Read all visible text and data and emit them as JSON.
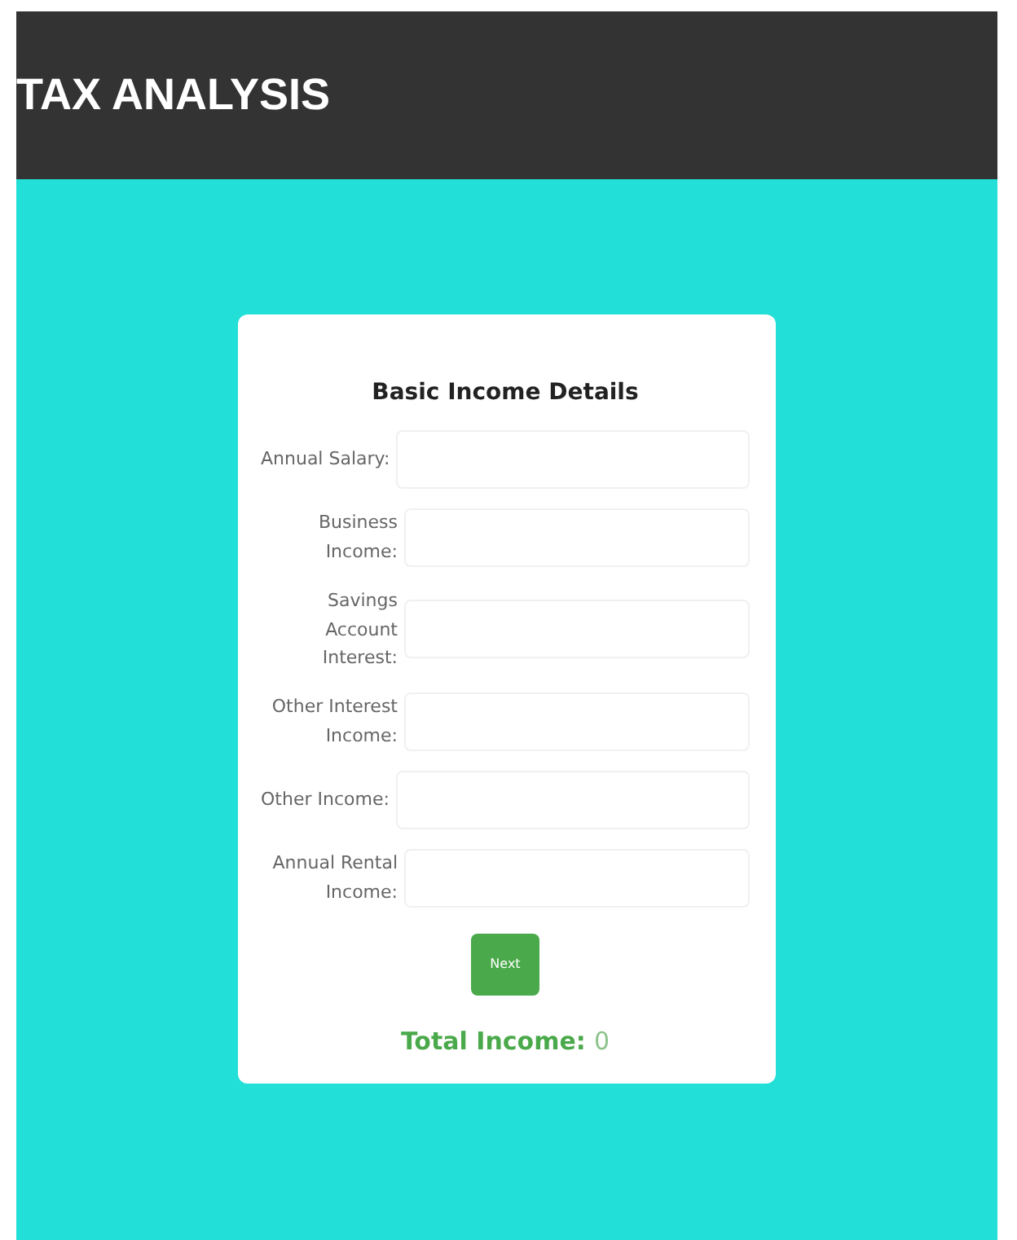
{
  "header": {
    "title": "TAX ANALYSIS"
  },
  "form": {
    "title": "Basic Income Details",
    "fields": [
      {
        "label": "Annual Salary:"
      },
      {
        "label": "Business Income:"
      },
      {
        "label": "Savings Account Interest:"
      },
      {
        "label": "Other Interest Income:"
      },
      {
        "label": "Other Income:"
      },
      {
        "label": "Annual Rental Income:"
      }
    ],
    "button": "Next",
    "total": {
      "label": "Total Income:",
      "value": "0"
    }
  }
}
